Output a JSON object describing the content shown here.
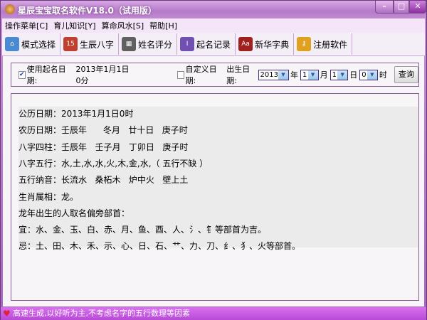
{
  "window": {
    "title": "星辰宝宝取名软件V18.0（试用版）",
    "minimize": "–",
    "maximize": "□",
    "close": "✕"
  },
  "menu": [
    "操作菜单[C]",
    "育儿知识[Y]",
    "算命风水[S]",
    "帮助[H]"
  ],
  "toolbar": [
    {
      "label": "模式选择",
      "icon": "home-icon",
      "glyph": "⌂",
      "color": "#4a8ad0"
    },
    {
      "label": "生辰八字",
      "icon": "calendar-icon",
      "glyph": "15",
      "color": "#c04030"
    },
    {
      "label": "姓名评分",
      "icon": "phone-icon",
      "glyph": "▦",
      "color": "#606060"
    },
    {
      "label": "起名记录",
      "icon": "notebook-icon",
      "glyph": "I",
      "color": "#7050b0"
    },
    {
      "label": "新华字典",
      "icon": "dictionary-icon",
      "glyph": "Aa",
      "color": "#a02020"
    },
    {
      "label": "注册软件",
      "icon": "key-icon",
      "glyph": "⚷",
      "color": "#e0a020"
    }
  ],
  "filter": {
    "use_date_label": "使用起名日期:",
    "use_date_checked": true,
    "use_date_value": "2013年1月1日0分",
    "custom_date_label": "自定义日期:",
    "custom_date_checked": false,
    "birth_label": "出生日期:",
    "year": "2013",
    "year_unit": "年",
    "month": "1",
    "month_unit": "月",
    "day": "1",
    "day_unit": "日",
    "hour": "0",
    "hour_unit": "时",
    "query": "查询"
  },
  "results": [
    "公历日期：2013年1月1日0时",
    "农历日期：壬辰年      冬月   廿十日   庚子时",
    "八字四柱：壬辰年   壬子月   丁卯日   庚子时",
    "八字五行：水,土,水,水,火,木,金,水,（ 五行不缺 ）",
    "五行纳音：长流水   桑柘木   炉中火   壁上土",
    "生肖属相：龙。",
    "龙年出生的人取名偏旁部首：",
    "宜：水、金、玉、白、赤、月、鱼、酉、人、氵、钅等部首为吉。",
    "忌：土、田、木、禾、示、心、日、石、艹、力、刀、纟、犭、火等部首。"
  ],
  "status": "高速生成,以好听为主,不考虑名字的五行数理等因素"
}
